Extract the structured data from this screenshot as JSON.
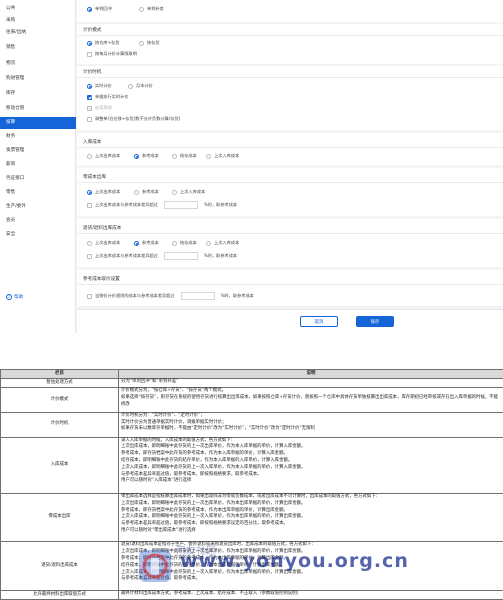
{
  "sidebar": {
    "items": [
      "公共",
      "采购",
      "往来/出纳",
      "销售",
      "物流",
      "购进管理",
      "库存",
      "移动仓管",
      "核算",
      "财务",
      "发票管理",
      "薪资",
      "凭证接口",
      "零售",
      "生产/委外",
      "会员",
      "安全"
    ],
    "active_index": 8,
    "help_label": "帮助"
  },
  "settings": {
    "mode_radios": [
      "单到回冲",
      "单到补差"
    ],
    "valuation": {
      "title": "计价模式",
      "radios": [
        "按仓库+存货",
        "按存货"
      ],
      "check": "按每月计价计算限取明"
    },
    "timing": {
      "title": "计价时机",
      "radios": [
        "实时计价",
        "月末计价"
      ],
      "checks": [
        "单据执行实时计价",
        "启用周期",
        "调整单(仓位移+存货)数不允许负数计算(存货)"
      ]
    },
    "inbound": {
      "title": "入库成本",
      "radios": [
        "上次出库成本",
        "参考成本",
        "结存成本",
        "上次入库成本"
      ]
    },
    "zero_outbound": {
      "title": "零成本出库",
      "radios": [
        "上次出库成本",
        "参考成本",
        "上次入库成本"
      ],
      "check_prefix": "上次出库成本与参考成本差异超过",
      "check_suffix": "%时，取参考成本"
    },
    "return": {
      "title": "退货/退料出库成本",
      "radios": [
        "上次出库成本",
        "参考成本",
        "结存成本",
        "上次入库成本"
      ],
      "check_prefix": "上次出库成本与参考成本差异超过",
      "check_suffix": "%时，取参考成本"
    },
    "reference": {
      "title": "参考成本取价设置",
      "check_prefix": "当物价计价规则的成本与参考成本差异超过",
      "check_suffix": "%时，取参考成本"
    },
    "cancel_label": "取消",
    "save_label": "保存"
  },
  "table": {
    "headers": [
      "栏目",
      "说明"
    ],
    "rows": [
      {
        "item": "暂估处理方式",
        "desc": "分为“单到回冲”和“单到补差”"
      },
      {
        "item": "计价模式",
        "desc": "计价模式分为，“按仓库+存货”、“按存货”两个模式。\n如果选择“按存货”，则存货在系统的使用存货进行核算出出库成本，如果按照仓库+存货计价，则按照一个仓库中具体存货单独核算出出库成本，库存期初已经审核或存在出入库单据的时候，不能修改"
      },
      {
        "item": "计价时机",
        "desc": "计价时机分为：“实时计价”、“定时计价”；\n实时计价分为普通单据实时计价，调拨单据实时计价；\n如果存货未以数库存单据时，不能由“定时计价”改为“实时计价”，“实时计价”改为“定时计价”无限制"
      },
      {
        "item": "入库成本",
        "desc": "录入入库单据的时候，入库成本的取值方式，各方式如下：\n上次出库成本，即明细账中此存货的上一次出库单价，作为本入库单据的单价，计算入库金额。\n参考成本，即存货档案中此存货的参考成本，作为本入库单据的单价，计算入库金额。\n结存成本，即明细账中此存货的结存单价，作为本入库单据的入库单价，计算入库金额。\n上次入库成本，即明细账中此存货的上一次入库单价，作为本入库单据的单价，计算入库金额。\n与参考成本差异率超过值，取参考成本，即按照规格要求，取参考成本。\n用户可以随时对“入库成本”进行选择"
      },
      {
        "item": "零成本出库",
        "desc": "零出库成本选择是指核算出库成本时，如果出现除非为零或负数成本，或者出库成本不可计算时，出库成本的取值方式，各方式如下：\n上次出库成本，即明细账中此存货的上一次出库单价，作为本出库单据的单价，计算出库金额。\n参考成本，即存货档案中此存货的参考成本，作为本出库单据的单价，计算出库金额。\n上次入库成本，即明细账中此存货的上一次入库单价，作为本出库单据的单价，计算出库金额。\n与参考成本差异率超过值，取参考成本，即按照规格要求设定的百分比，取参考成本。\n用户可以随时对“零出库成本”进行选择"
      },
      {
        "item": "退货/退料出库成本",
        "desc": "退货/退料出库成本是指对于生产、委外退料或采购退货出库时，出库成本的取值方式，各方式如下：\n上次出库成本，即明细账中此存货的上一次出库单价，作为本出库单据的单价，计算出库金额。\n参考成本，即存货档案中此存货的参考成本，作为本出库单据的单价，计算出库金额。\n结存成本，即明细账中此存货的结存单价，作为本出库单据的单价，计算出库金额。\n上次入库成本，即明细账中此存货的上一次入库单价，作为本出库单据的单价，计算出库金额。\n与参考成本差异率超过值，取参考成本。"
      },
      {
        "item": "允许最终材料出库取值方式",
        "desc": "最终计材料出库成本方式，参考成本、上次成本、结存成本、不正取入（参数取值控制说明）"
      }
    ]
  },
  "watermark": {
    "text": "www.yonyou.org.cn",
    "cn": "用友社区"
  }
}
